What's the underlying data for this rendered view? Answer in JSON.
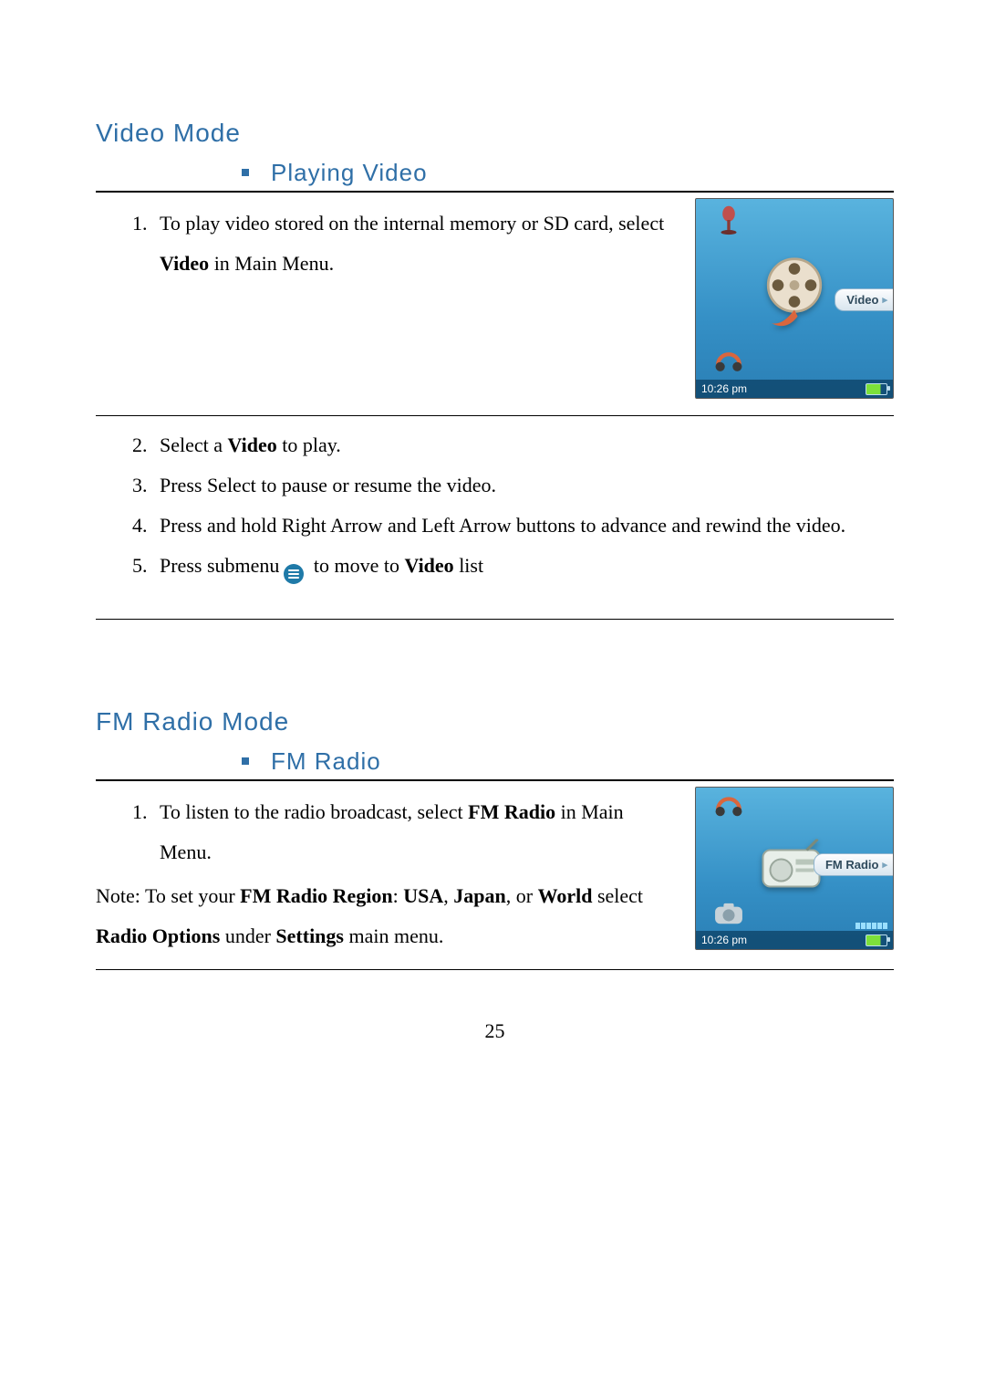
{
  "page_number": "25",
  "video_section": {
    "heading": "Video Mode",
    "sub_heading": "Playing Video",
    "steps_block1": [
      {
        "pre": "To play video stored on the internal memory or SD card, select ",
        "bold": "Video",
        "post": " in Main Menu."
      }
    ],
    "steps_block2": [
      {
        "pre": "Select a ",
        "bold": "Video",
        "post": " to play."
      },
      {
        "pre": "Press Select to pause or resume the video.",
        "bold": "",
        "post": ""
      },
      {
        "pre": "Press and hold Right Arrow and Left Arrow buttons to advance and rewind the video.",
        "bold": "",
        "post": ""
      },
      {
        "pre": "Press submenu",
        "bold": "",
        "post": "",
        "post_icon": "submenu-icon",
        "post2": " to move to ",
        "bold2": "Video",
        "post3": " list"
      }
    ],
    "screenshot": {
      "label": "Video",
      "time": "10:26 pm"
    }
  },
  "fm_section": {
    "heading": "FM Radio Mode",
    "sub_heading": "FM Radio",
    "step": {
      "pre": "To listen to the radio broadcast, select ",
      "bold": "FM Radio",
      "post": " in Main Menu."
    },
    "note": {
      "pre": "Note: To set your ",
      "b1": "FM Radio Region",
      "mid1": ": ",
      "b2": "USA",
      "mid2": ", ",
      "b3": "Japan",
      "mid3": ", or ",
      "b4": "World",
      "mid4": " select ",
      "b5": "Radio Options",
      "mid5": " under ",
      "b6": "Settings",
      "post": " main menu."
    },
    "screenshot": {
      "label": "FM Radio",
      "time": "10:26 pm"
    }
  }
}
